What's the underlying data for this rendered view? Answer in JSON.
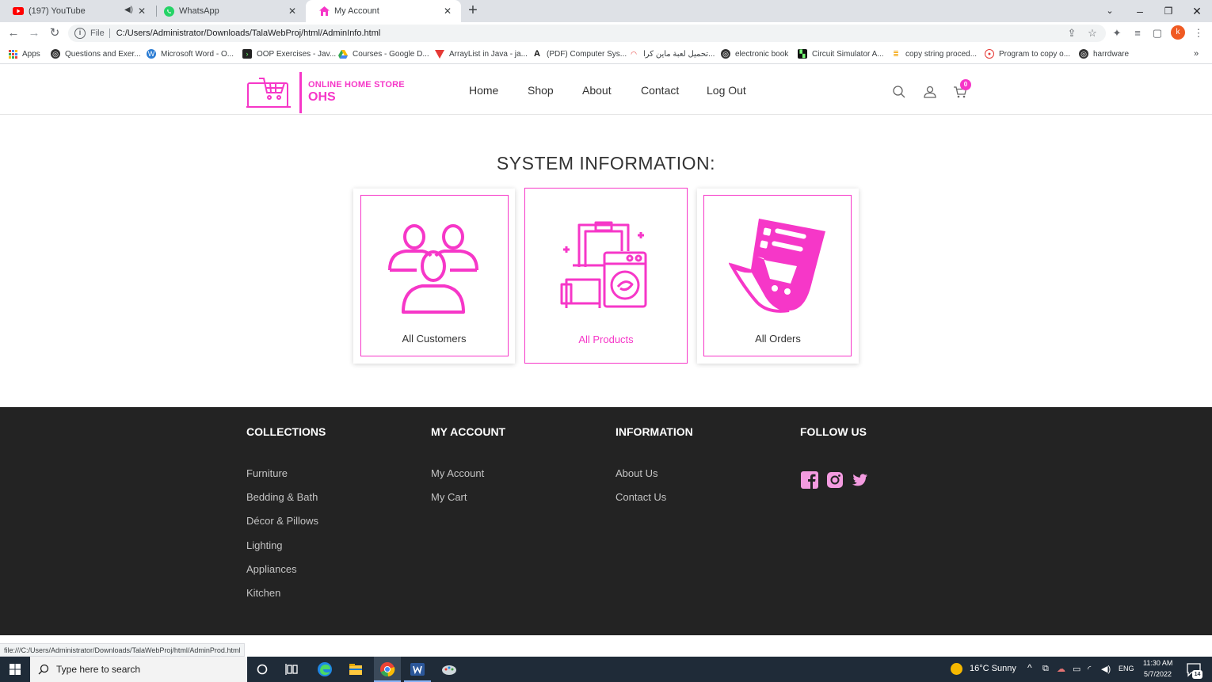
{
  "browser": {
    "tabs": [
      {
        "title": "(197) YouTube",
        "icon": "youtube-icon"
      },
      {
        "title": "WhatsApp",
        "icon": "whatsapp-icon"
      },
      {
        "title": "My Account",
        "icon": "home-icon"
      }
    ],
    "url_scheme": "File",
    "url": "C:/Users/Administrator/Downloads/TalaWebProj/html/AdminInfo.html",
    "profile_initial": "k",
    "bookmarks": [
      "Apps",
      "Questions and Exer...",
      "Microsoft Word - O...",
      "OOP Exercises - Jav...",
      "Courses - Google D...",
      "ArrayList in Java - ja...",
      "(PDF) Computer Sys...",
      "تحميل لعبة ماين كرا...",
      "electronic book",
      "Circuit Simulator A...",
      "copy string proced...",
      "Program to copy o...",
      "harrdware"
    ],
    "status_url": "file:///C:/Users/Administrator/Downloads/TalaWebProj/html/AdminProd.html"
  },
  "site": {
    "logo_line1": "ONLINE HOME STORE",
    "logo_line2": "OHS",
    "nav": [
      "Home",
      "Shop",
      "About",
      "Contact",
      "Log Out"
    ],
    "cart_count": "0",
    "accent_color": "#f637c8"
  },
  "main": {
    "title": "SYSTEM INFORMATION:",
    "cards": [
      {
        "label": "All Customers",
        "icon": "customers-icon"
      },
      {
        "label": "All Products",
        "icon": "products-icon"
      },
      {
        "label": "All Orders",
        "icon": "orders-icon"
      }
    ]
  },
  "footer": {
    "collections": {
      "title": "COLLECTIONS",
      "links": [
        "Furniture",
        "Bedding & Bath",
        "Décor & Pillows",
        "Lighting",
        "Appliances",
        "Kitchen"
      ]
    },
    "account": {
      "title": "MY ACCOUNT",
      "links": [
        "My Account",
        "My Cart"
      ]
    },
    "information": {
      "title": "INFORMATION",
      "links": [
        "About Us",
        "Contact Us"
      ]
    },
    "follow": {
      "title": "FOLLOW US",
      "icons": [
        "facebook-icon",
        "instagram-icon",
        "twitter-icon"
      ]
    }
  },
  "taskbar": {
    "search_placeholder": "Type here to search",
    "weather": "16°C  Sunny",
    "language": "ENG",
    "time": "11:30 AM",
    "date": "5/7/2022",
    "notification_count": "14"
  }
}
